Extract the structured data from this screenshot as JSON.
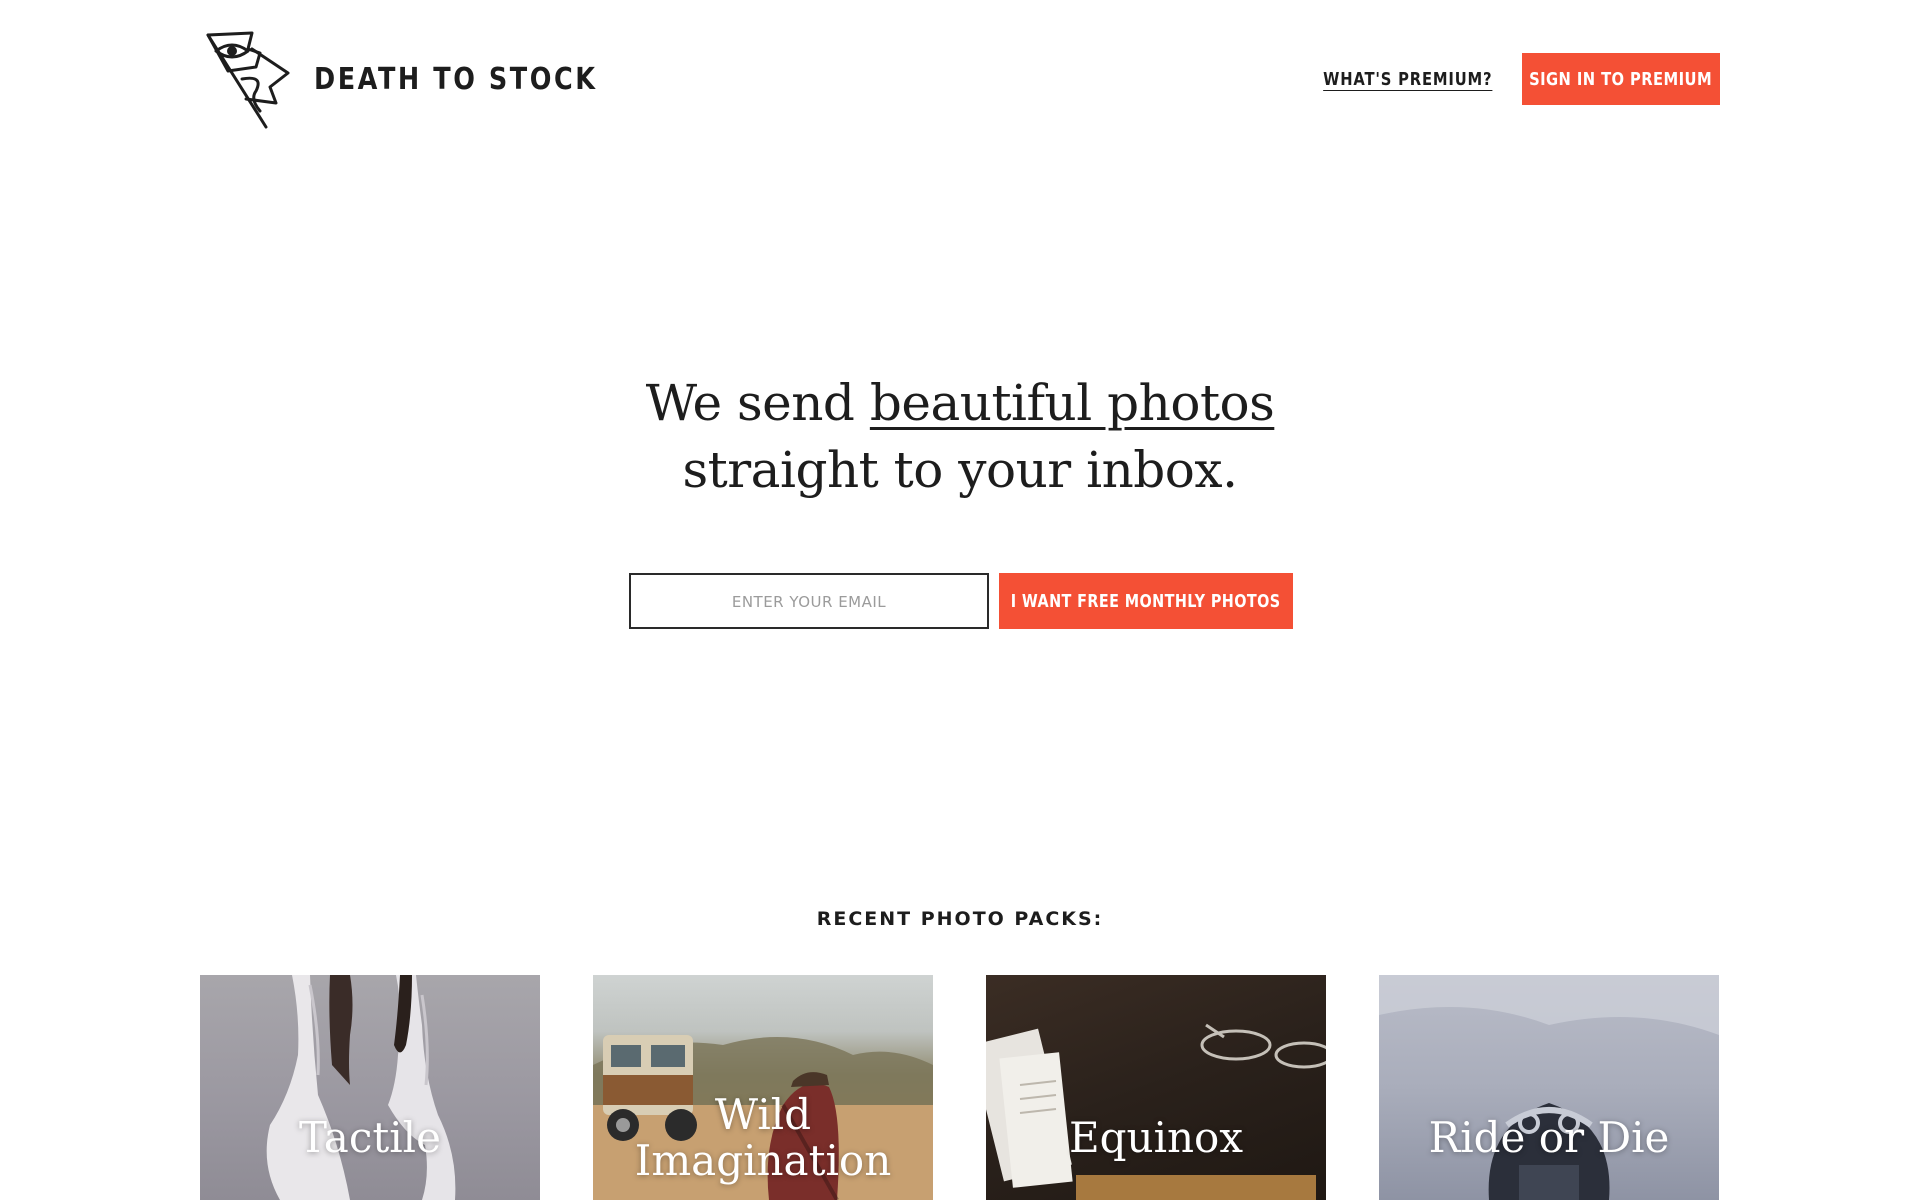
{
  "brand": {
    "name": "DEATH TO STOCK",
    "logo_icon": "eye-flag-logo"
  },
  "nav": {
    "whats_premium": "WHAT'S PREMIUM?",
    "sign_in": "SIGN IN TO PREMIUM"
  },
  "hero": {
    "line1_prefix": "We send",
    "line1_link": "beautiful photos",
    "line2": "straight to your inbox."
  },
  "signup": {
    "email_placeholder": "ENTER YOUR EMAIL",
    "email_value": "",
    "button_label": "I WANT FREE MONTHLY PHOTOS"
  },
  "recent": {
    "heading": "RECENT PHOTO PACKS:",
    "packs": [
      {
        "title": "Tactile"
      },
      {
        "title": "Wild Imagination"
      },
      {
        "title": "Equinox"
      },
      {
        "title": "Ride or Die"
      }
    ]
  },
  "colors": {
    "accent": "#f45035",
    "text": "#1d1d1d",
    "background": "#ffffff"
  }
}
